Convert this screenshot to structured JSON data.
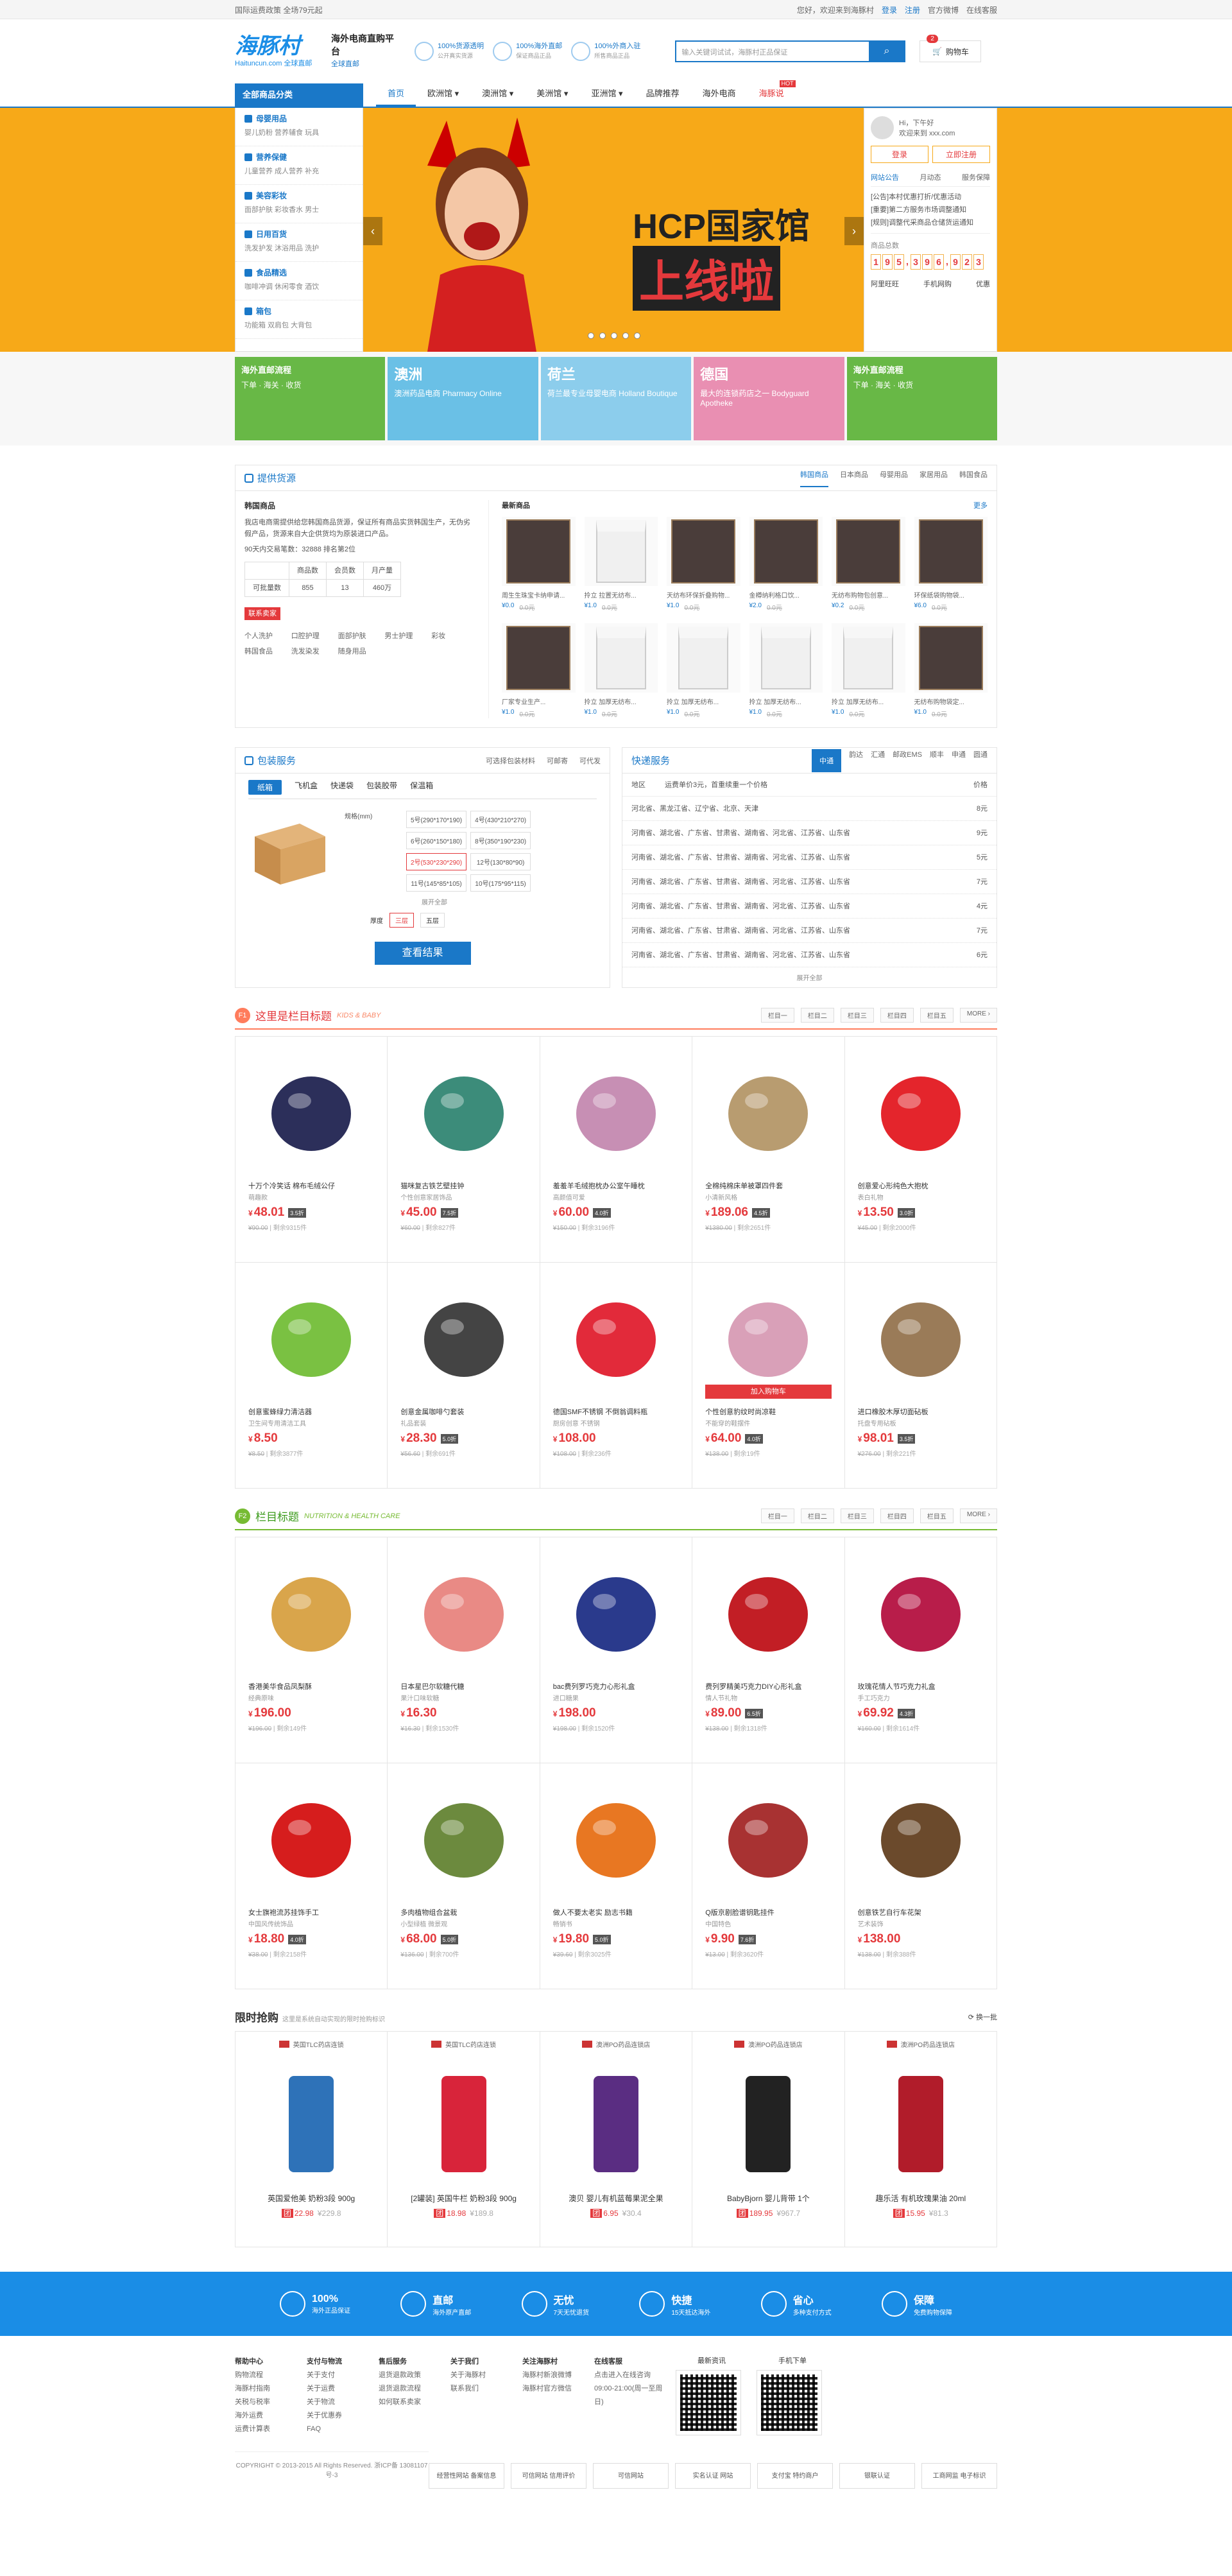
{
  "topbar": {
    "left": "国际运费政策 全场79元起",
    "hello": "您好，",
    "welcome": "欢迎来到海豚村",
    "login": "登录",
    "register": "注册",
    "weibo": "官方微博",
    "service": "在线客服"
  },
  "header": {
    "logo": "海豚村",
    "logo_sub": "Haituncun.com 全球直邮",
    "slogan": "海外电商直购平台",
    "slogan_sub": "全球直邮",
    "promises": [
      {
        "t": "100%货源透明",
        "s": "公开真实货源"
      },
      {
        "t": "100%海外直邮",
        "s": "保证商品正品"
      },
      {
        "t": "100%外商入驻",
        "s": "所售商品正品"
      }
    ],
    "search_placeholder": "输入关键词试试，海豚村正品保证",
    "search_btn": "⌕",
    "cart": "购物车",
    "cart_count": "2"
  },
  "nav": {
    "cat": "全部商品分类",
    "items": [
      "首页",
      "欧洲馆 ▾",
      "澳洲馆 ▾",
      "美洲馆 ▾",
      "亚洲馆 ▾",
      "品牌推荐",
      "海外电商",
      "海豚说"
    ],
    "hot_tag": "HOT"
  },
  "categories": [
    {
      "h": "母婴用品",
      "s": "婴儿奶粉  营养辅食  玩具"
    },
    {
      "h": "营养保健",
      "s": "儿童营养  成人营养  补充"
    },
    {
      "h": "美容彩妆",
      "s": "面部护肤  彩妆香水  男士"
    },
    {
      "h": "日用百货",
      "s": "洗发护发  沐浴用品  洗护"
    },
    {
      "h": "食品精选",
      "s": "咖啡冲调  休闲零食  酒饮"
    },
    {
      "h": "箱包",
      "s": "功能箱  双肩包  大背包"
    }
  ],
  "banner": {
    "title": "HCP国家馆",
    "title2": "上线啦"
  },
  "login": {
    "greet": "Hi，下午好",
    "greet2": "欢迎来到 xxx.com",
    "login": "登录",
    "register": "立即注册",
    "tabs": [
      "网站公告",
      "月动态",
      "服务保障"
    ],
    "news": [
      "[公告]本村优惠打折/优惠活动",
      "[重要]第二方服务市场调整通知",
      "[规则]调整代采商品仓储货运通知"
    ],
    "count_label": "商品总数",
    "count": [
      "1",
      "9",
      "5",
      "3",
      "9",
      "6",
      "9",
      "2",
      "3"
    ],
    "services": [
      "阿里旺旺",
      "手机网购",
      "优惠"
    ]
  },
  "strips": [
    {
      "t": "海外直邮流程",
      "s": "下单 · 海关 · 收货"
    },
    {
      "t": "澳洲",
      "s": "澳洲药品电商 Pharmacy Online"
    },
    {
      "t": "荷兰",
      "s": "荷兰最专业母婴电商 Holland Boutique"
    },
    {
      "t": "德国",
      "s": "最大的连锁药店之一 Bodyguard Apotheke"
    },
    {
      "t": "海外直邮流程",
      "s": "下单 · 海关 · 收货"
    }
  ],
  "supply": {
    "title": "提供货源",
    "tabs": [
      "韩国商品",
      "日本商品",
      "母婴用品",
      "家居用品",
      "韩国食品"
    ],
    "left_title": "韩国商品",
    "desc": "我店电商需提供给您韩国商品货源，保证所有商品实货韩国生产，无伪劣假产品，货源来自大企供货均为原装进口产品。",
    "stat": "90天内交易笔数：32888  排名第2位",
    "table": [
      [
        "",
        "商品数",
        "会员数",
        "月产量"
      ],
      [
        "可批量数",
        "855",
        "13",
        "460万"
      ]
    ],
    "pill": "联系卖家",
    "tags": [
      "个人洗护",
      "口腔护理",
      "面部护肤",
      "男士护理",
      "彩妆",
      "韩国食品",
      "洗发染发",
      "随身用品"
    ],
    "right_title": "最新商品",
    "more": "更多",
    "products": [
      {
        "n": "周生生珠宝卡纳申请...",
        "p": "¥0.0",
        "o": "0.0元",
        "k": "box"
      },
      {
        "n": "拎立 拉置无纺布...",
        "p": "¥1.0",
        "o": "0.0元",
        "k": "bag"
      },
      {
        "n": "天纺布环保折叠购物...",
        "p": "¥1.0",
        "o": "0.0元",
        "k": "box"
      },
      {
        "n": "金樽纳利格口饮...",
        "p": "¥2.0",
        "o": "0.0元",
        "k": "box"
      },
      {
        "n": "无纺布购物包创意...",
        "p": "¥0.2",
        "o": "0.0元",
        "k": "box"
      },
      {
        "n": "环保纸袋购物袋...",
        "p": "¥6.0",
        "o": "0.0元",
        "k": "box"
      },
      {
        "n": "厂家专业生产...",
        "p": "¥1.0",
        "o": "0.0元",
        "k": "box"
      },
      {
        "n": "拎立 加厚无纺布...",
        "p": "¥1.0",
        "o": "0.0元",
        "k": "bag"
      },
      {
        "n": "拎立 加厚无纺布...",
        "p": "¥1.0",
        "o": "0.0元",
        "k": "bag"
      },
      {
        "n": "拎立 加厚无纺布...",
        "p": "¥1.0",
        "o": "0.0元",
        "k": "bag"
      },
      {
        "n": "拎立 加厚无纺布...",
        "p": "¥1.0",
        "o": "0.0元",
        "k": "bag"
      },
      {
        "n": "无纺布购物袋定...",
        "p": "¥1.0",
        "o": "0.0元",
        "k": "box"
      }
    ]
  },
  "pack": {
    "title": "包装服务",
    "links": [
      "可选择包装材料",
      "可邮寄",
      "可代发"
    ],
    "tabs": [
      "纸箱",
      "飞机盒",
      "快递袋",
      "包装胶带",
      "保温箱"
    ],
    "size_label": "规格(mm)",
    "sizes": [
      "5号(290*170*190)",
      "4号(430*210*270)",
      "6号(260*150*180)",
      "8号(350*190*230)",
      "2号(530*230*290)",
      "12号(130*80*90)",
      "11号(145*85*105)",
      "10号(175*95*115)"
    ],
    "expand": "展开全部",
    "thick_label": "厚度",
    "thick": [
      "三层",
      "五层"
    ],
    "btn": "查看结果"
  },
  "express": {
    "title": "快递服务",
    "tabs": [
      "中通",
      "韵达",
      "汇通",
      "邮政EMS",
      "顺丰",
      "申通",
      "圆通"
    ],
    "head_l": "地区",
    "head_m": "运费单价3元，首重续重一个价格",
    "head_r": "价格",
    "rows": [
      [
        "河北省、黑龙江省、辽宁省、北京、天津",
        "8元"
      ],
      [
        "河南省、湖北省、广东省、甘肃省、湖南省、河北省、江苏省、山东省",
        "9元"
      ],
      [
        "河南省、湖北省、广东省、甘肃省、湖南省、河北省、江苏省、山东省",
        "5元"
      ],
      [
        "河南省、湖北省、广东省、甘肃省、湖南省、河北省、江苏省、山东省",
        "7元"
      ],
      [
        "河南省、湖北省、广东省、甘肃省、湖南省、河北省、江苏省、山东省",
        "4元"
      ],
      [
        "河南省、湖北省、广东省、甘肃省、湖南省、河北省、江苏省、山东省",
        "7元"
      ],
      [
        "河南省、湖北省、广东省、甘肃省、湖南省、河北省、江苏省、山东省",
        "6元"
      ]
    ],
    "expand": "展开全部"
  },
  "floor1": {
    "num": "F1",
    "title": "这里是栏目标题",
    "en": "KIDS & BABY",
    "links": [
      "栏目一",
      "栏目二",
      "栏目三",
      "栏目四",
      "栏目五",
      "MORE ›"
    ],
    "items": [
      {
        "n": "十万个冷笑话 棉布毛绒公仔",
        "s": "萌趣款",
        "p": "48.01",
        "d": "3.5折",
        "o": "¥90.00",
        "r": "剩余9315件",
        "c": "#2c2f5a"
      },
      {
        "n": "猫咪复古铁艺壁挂钟",
        "s": "个性创意家居饰品",
        "p": "45.00",
        "d": "7.5折",
        "o": "¥60.00",
        "r": "剩余827件",
        "c": "#3c8c7a"
      },
      {
        "n": "羞羞羊毛绒抱枕办公室午睡枕",
        "s": "高颜值可爱",
        "p": "60.00",
        "d": "4.0折",
        "o": "¥150.00",
        "r": "剩余3196件",
        "c": "#c78fb4"
      },
      {
        "n": "全棉纯棉床单被罩四件套",
        "s": "小清新风格",
        "p": "189.06",
        "d": "4.5折",
        "o": "¥1380.00",
        "r": "剩余2651件",
        "c": "#b89c70"
      },
      {
        "n": "创意爱心形纯色大抱枕",
        "s": "表白礼物",
        "p": "13.50",
        "d": "3.0折",
        "o": "¥45.00",
        "r": "剩余2000件",
        "c": "#e4252c"
      },
      {
        "n": "创意蜜蜂绿力清洁器",
        "s": "卫生间专用清洁工具",
        "p": "8.50",
        "d": "",
        "o": "¥8.50",
        "r": "剩余3877件",
        "c": "#7ac142"
      },
      {
        "n": "创意金属咖啡勺套装",
        "s": "礼品套装",
        "p": "28.30",
        "d": "5.0折",
        "o": "¥56.60",
        "r": "剩余691件",
        "c": "#444"
      },
      {
        "n": "德国SMF不锈钢 不倒翁调料瓶",
        "s": "厨房创意 不锈钢",
        "p": "108.00",
        "d": "",
        "o": "¥108.00",
        "r": "剩余236件",
        "c": "#e22a3a"
      },
      {
        "n": "个性创意豹纹时尚凉鞋",
        "s": "不能穿的鞋摆件",
        "p": "64.00",
        "d": "4.0折",
        "o": "¥138.00",
        "r": "剩余19件",
        "c": "#d9a0b8"
      },
      {
        "n": "进口橡胶木厚切面砧板",
        "s": "托盘专用砧板",
        "p": "98.01",
        "d": "3.5折",
        "o": "¥276.00",
        "r": "剩余221件",
        "c": "#9a7b58"
      }
    ]
  },
  "floor2": {
    "num": "F2",
    "title": "栏目标题",
    "en": "NUTRITION & HEALTH CARE",
    "links": [
      "栏目一",
      "栏目二",
      "栏目三",
      "栏目四",
      "栏目五",
      "MORE ›"
    ],
    "items": [
      {
        "n": "香港美华食品凤梨酥",
        "s": "经典原味",
        "p": "196.00",
        "d": "",
        "o": "¥196.00",
        "r": "剩余149件",
        "c": "#d9a54b"
      },
      {
        "n": "日本星巴尔软糖代糖",
        "s": "果汁口味软糖",
        "p": "16.30",
        "d": "",
        "o": "¥16.30",
        "r": "剩余1530件",
        "c": "#e98a85"
      },
      {
        "n": "bac费列罗巧克力心形礼盒",
        "s": "进口糖果",
        "p": "198.00",
        "d": "",
        "o": "¥198.00",
        "r": "剩余1520件",
        "c": "#2a3a8c"
      },
      {
        "n": "费列罗精美巧克力DIY心形礼盒",
        "s": "情人节礼物",
        "p": "89.00",
        "d": "6.5折",
        "o": "¥138.00",
        "r": "剩余1318件",
        "c": "#c21e25"
      },
      {
        "n": "玫瑰花情人节巧克力礼盒",
        "s": "手工巧克力",
        "p": "69.92",
        "d": "4.3折",
        "o": "¥160.00",
        "r": "剩余1614件",
        "c": "#b81d4a"
      },
      {
        "n": "女士旗袍流苏挂饰手工",
        "s": "中国风传统饰品",
        "p": "18.80",
        "d": "4.0折",
        "o": "¥38.00",
        "r": "剩余2158件",
        "c": "#d61d1d"
      },
      {
        "n": "多肉植物组合盆栽",
        "s": "小型绿植 微景观",
        "p": "68.00",
        "d": "5.0折",
        "o": "¥136.00",
        "r": "剩余700件",
        "c": "#6c8a3e"
      },
      {
        "n": "做人不要太老实 励志书籍",
        "s": "畅销书",
        "p": "19.80",
        "d": "5.0折",
        "o": "¥39.60",
        "r": "剩余3025件",
        "c": "#e87722"
      },
      {
        "n": "Q版京剧脸谱钥匙挂件",
        "s": "中国特色",
        "p": "9.90",
        "d": "7.6折",
        "o": "¥13.00",
        "r": "剩余3620件",
        "c": "#a83232"
      },
      {
        "n": "创意铁艺自行车花架",
        "s": "艺术装饰",
        "p": "138.00",
        "d": "",
        "o": "¥138.00",
        "r": "剩余388件",
        "c": "#6b4a2c"
      }
    ]
  },
  "flash": {
    "title": "限时抢购",
    "sub": "这里是系统自动实现的限时抢购标识",
    "refresh": "换一批",
    "items": [
      {
        "src": "英国TLC药店连锁",
        "n": "英国爱他美 奶粉3段 900g",
        "p": "22.98",
        "o": "¥229.8",
        "tag": "团",
        "c": "#2e72b8"
      },
      {
        "src": "英国TLC药店连锁",
        "n": "[2罐装] 英国牛栏 奶粉3段 900g",
        "p": "18.98",
        "o": "¥189.8",
        "tag": "团",
        "c": "#d8243a"
      },
      {
        "src": "澳洲PO药品连锁店",
        "n": "澳贝 婴儿有机蓝莓果泥全果",
        "p": "6.95",
        "o": "¥30.4",
        "tag": "团",
        "c": "#5a2d82"
      },
      {
        "src": "澳洲PO药品连锁店",
        "n": "BabyBjorn 婴儿背带 1个",
        "p": "189.95",
        "o": "¥967.7",
        "tag": "团",
        "c": "#222"
      },
      {
        "src": "澳洲PO药品连锁店",
        "n": "趣乐活 有机玫瑰果油 20ml",
        "p": "15.95",
        "o": "¥81.3",
        "tag": "团",
        "c": "#b11c2a"
      }
    ]
  },
  "services": [
    {
      "t": "100%",
      "s": "海外正品保证"
    },
    {
      "t": "直邮",
      "s": "海外原产直邮"
    },
    {
      "t": "无忧",
      "s": "7天无忧退货"
    },
    {
      "t": "快捷",
      "s": "15天抵达海外"
    },
    {
      "t": "省心",
      "s": "多种支付方式"
    },
    {
      "t": "保障",
      "s": "免费购物保障"
    }
  ],
  "footer": {
    "cols": [
      {
        "h": "帮助中心",
        "l": [
          "购物流程",
          "海豚村指南",
          "关税与税率",
          "海外运费",
          "运费计算表"
        ]
      },
      {
        "h": "支付与物流",
        "l": [
          "关于支付",
          "关于运费",
          "关于物流",
          "关于优惠券",
          "FAQ"
        ]
      },
      {
        "h": "售后服务",
        "l": [
          "退货退款政策",
          "退货退款流程",
          "如何联系卖家"
        ]
      },
      {
        "h": "关于我们",
        "l": [
          "关于海豚村",
          "联系我们"
        ]
      },
      {
        "h": "关注海豚村",
        "l": [
          "海豚村新浪微博",
          "海豚村官方微信"
        ]
      },
      {
        "h": "在线客服",
        "l": [
          "点击进入在线咨询",
          "09:00-21:00(周一至周日)"
        ]
      }
    ],
    "qr1": "最新资讯",
    "qr2": "手机下单",
    "copyright": "COPYRIGHT © 2013-2015 All Rights Reserved. 浙ICP备 13081107号-3",
    "certs": [
      "经营性网站 备案信息",
      "可信网站 信用评价",
      "可信网站",
      "实名认证 网站",
      "支付宝 特约商户",
      "银联认证",
      "工商网监 电子标识"
    ]
  }
}
